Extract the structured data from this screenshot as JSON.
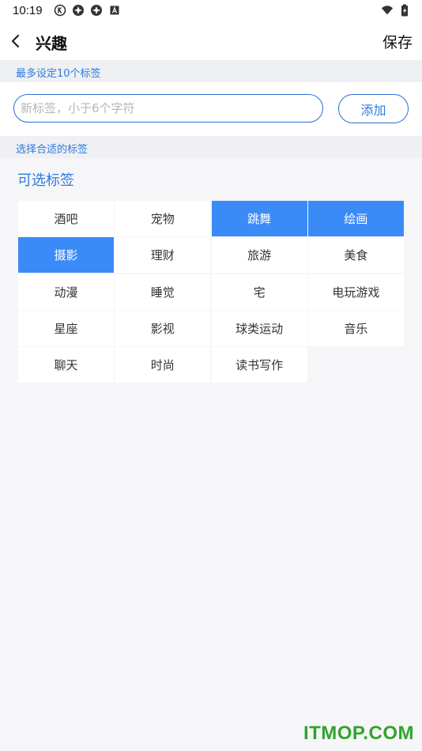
{
  "status_bar": {
    "time": "10:19",
    "left_icons": [
      "k-circle-icon",
      "pinwheel-icon",
      "pinwheel-icon",
      "a-box-icon"
    ],
    "right_icons": [
      "wifi-icon",
      "battery-charging-icon"
    ]
  },
  "header": {
    "title": "兴趣",
    "save_label": "保存"
  },
  "limit_hint": "最多设定10个标签",
  "new_tag": {
    "placeholder": "新标签，小于6个字符",
    "value": "",
    "add_label": "添加"
  },
  "choose_hint": "选择合适的标签",
  "tags_section": {
    "title": "可选标签",
    "tags": [
      {
        "label": "酒吧",
        "selected": false
      },
      {
        "label": "宠物",
        "selected": false
      },
      {
        "label": "跳舞",
        "selected": true
      },
      {
        "label": "绘画",
        "selected": true
      },
      {
        "label": "摄影",
        "selected": true
      },
      {
        "label": "理财",
        "selected": false
      },
      {
        "label": "旅游",
        "selected": false
      },
      {
        "label": "美食",
        "selected": false
      },
      {
        "label": "动漫",
        "selected": false
      },
      {
        "label": "睡觉",
        "selected": false
      },
      {
        "label": "宅",
        "selected": false
      },
      {
        "label": "电玩游戏",
        "selected": false
      },
      {
        "label": "星座",
        "selected": false
      },
      {
        "label": "影视",
        "selected": false
      },
      {
        "label": "球类运动",
        "selected": false
      },
      {
        "label": "音乐",
        "selected": false
      },
      {
        "label": "聊天",
        "selected": false
      },
      {
        "label": "时尚",
        "selected": false
      },
      {
        "label": "读书写作",
        "selected": false
      }
    ]
  },
  "colors": {
    "accent": "#2d7be0",
    "selected_bg": "#3a8bf7",
    "page_bg": "#f6f6f8"
  },
  "watermark": "ITMOP.COM"
}
